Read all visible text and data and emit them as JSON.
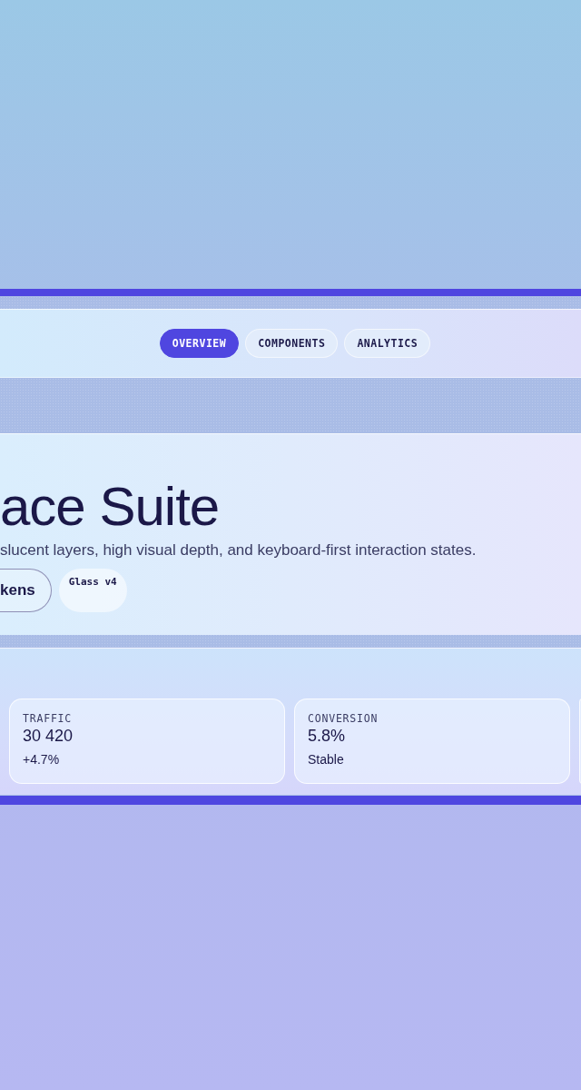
{
  "nav": {
    "tabs": [
      {
        "label": "OVERVIEW",
        "selected": true
      },
      {
        "label": "COMPONENTS",
        "selected": false
      },
      {
        "label": "ANALYTICS",
        "selected": false
      }
    ]
  },
  "hero": {
    "title": "ace Suite",
    "subtitle": "slucent layers, high visual depth, and keyboard-first interaction states.",
    "button": "kens",
    "badge": "Glass v4"
  },
  "metrics": [
    {
      "label": "TRAFFIC",
      "value": "30 420",
      "change": "+4.7%"
    },
    {
      "label": "CONVERSION",
      "value": "5.8%",
      "change": "Stable"
    }
  ]
}
